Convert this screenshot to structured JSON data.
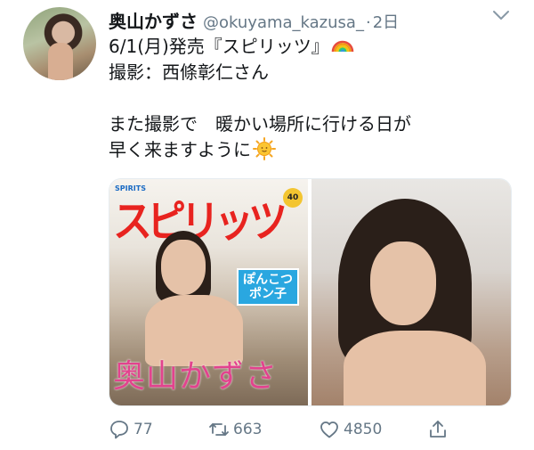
{
  "tweet": {
    "display_name": "奥山かずさ",
    "handle": "@okuyama_kazusa_",
    "separator": "·",
    "time": "2日",
    "text_lines": [
      "6/1(月)発売『スピリッツ』",
      "撮影：西條彰仁さん",
      "",
      "また撮影で　暖かい場所に行ける日が",
      "早く来ますように"
    ],
    "line1_emoji": "rainbow-icon",
    "line5_emoji": "sun-icon"
  },
  "media": {
    "left": {
      "magazine_logo": "スピリッツ",
      "magazine_sub": "SPIRITS",
      "badge": "40",
      "manga_title": "ぽんこつ ポン子",
      "model_name_text": "奥山かずさ"
    },
    "right": {}
  },
  "actions": {
    "reply_count": "77",
    "retweet_count": "663",
    "like_count": "4850",
    "reply_icon": "reply-icon",
    "retweet_icon": "retweet-icon",
    "like_icon": "heart-icon",
    "share_icon": "share-icon"
  },
  "colors": {
    "text": "#14171a",
    "secondary": "#657786",
    "magazine_red": "#e8231f",
    "name_pink": "#e2438e"
  }
}
